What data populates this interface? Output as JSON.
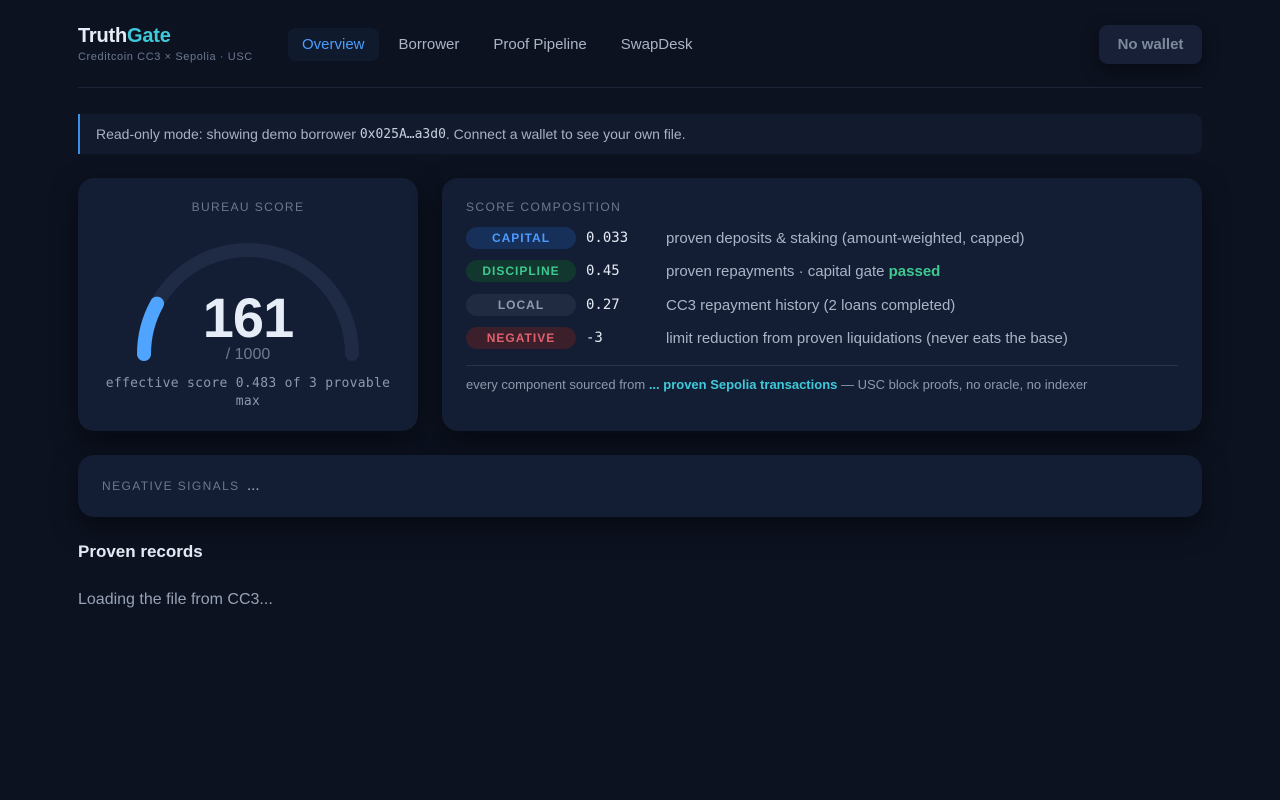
{
  "brand": {
    "name_main": "Truth",
    "name_accent": "Gate",
    "subtitle": "Creditcoin CC3 × Sepolia · USC"
  },
  "nav": {
    "items": [
      "Overview",
      "Borrower",
      "Proof Pipeline",
      "SwapDesk"
    ],
    "active": "Overview"
  },
  "wallet": {
    "label": "No wallet"
  },
  "notice": {
    "prefix": "Read-only mode: showing demo borrower ",
    "address": "0x025A…a3d0",
    "suffix": ". Connect a wallet to see your own file."
  },
  "bureau": {
    "label": "BUREAU SCORE",
    "score": "161",
    "score_fraction": 0.161,
    "max": "/ 1000",
    "effective": "effective score 0.483 of 3 provable max"
  },
  "composition": {
    "title": "SCORE COMPOSITION",
    "rows": [
      {
        "tag": "CAPITAL",
        "value": "0.033",
        "desc": "proven deposits & staking (amount-weighted, capped)"
      },
      {
        "tag": "DISCIPLINE",
        "value": "0.45",
        "desc": "proven repayments · capital gate ",
        "status": "passed"
      },
      {
        "tag": "LOCAL",
        "value": "0.27",
        "desc": "CC3 repayment history (2 loans completed)"
      },
      {
        "tag": "NEGATIVE",
        "value": "-3",
        "desc": "limit reduction from proven liquidations (never eats the base)"
      }
    ],
    "footer_prefix": "every component sourced from ",
    "footer_link": "... proven Sepolia transactions",
    "footer_suffix": " — USC block proofs, no oracle, no indexer"
  },
  "negative_signals": {
    "label": "NEGATIVE SIGNALS",
    "value": "..."
  },
  "records": {
    "title": "Proven records",
    "loading": "Loading the file from CC3..."
  },
  "colors": {
    "background": "#0c1220",
    "card": "#131d33",
    "accent_blue": "#4a9dff",
    "accent_cyan": "#3fc8d9",
    "accent_green": "#3ec890",
    "accent_red": "#e0606e"
  }
}
